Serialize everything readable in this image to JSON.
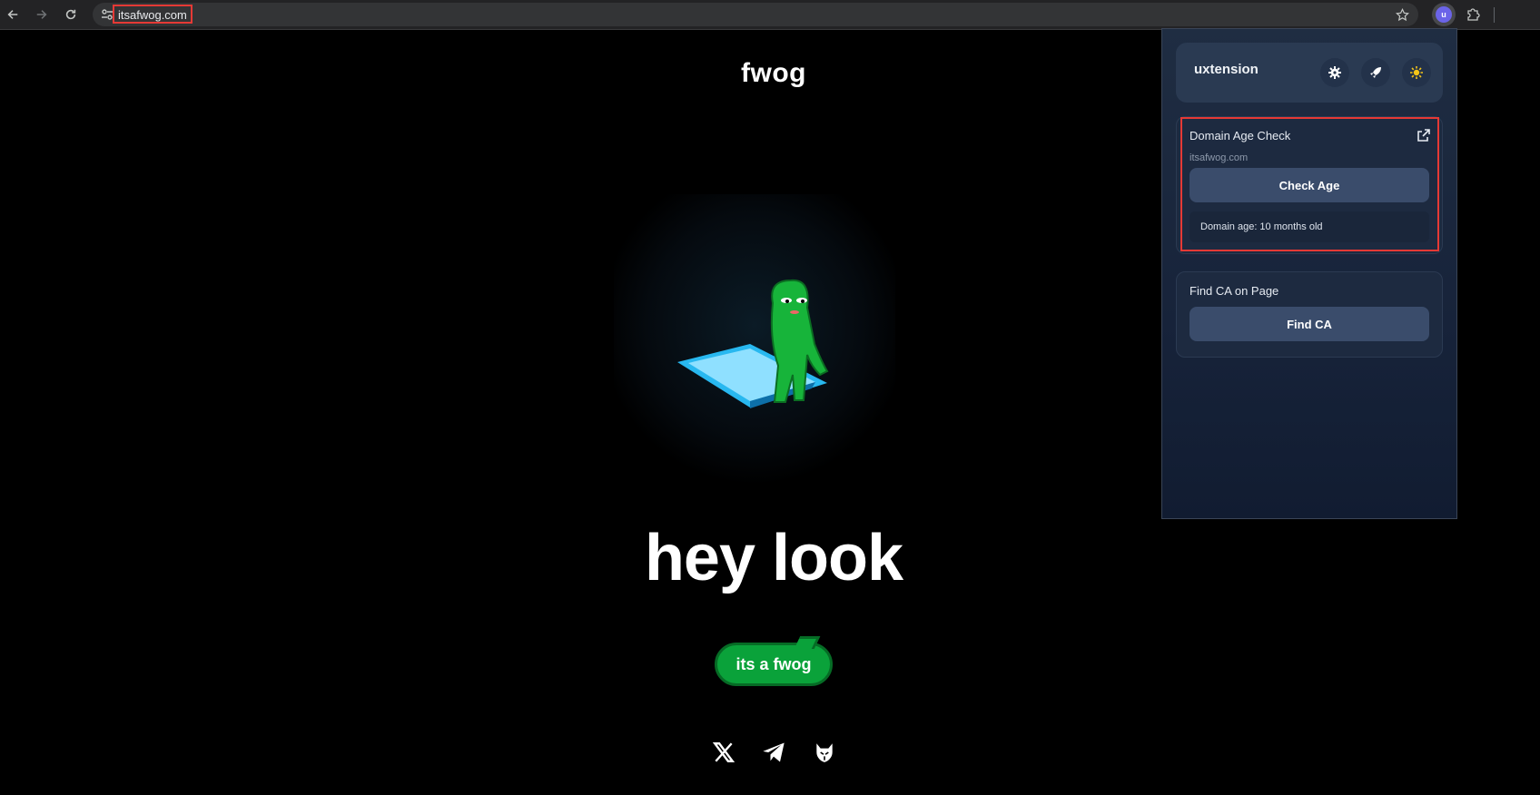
{
  "browser": {
    "url": "itsafwog.com"
  },
  "page": {
    "logo": "fwog",
    "headline": "hey look",
    "cta_label": "its a fwog",
    "social": [
      "x-icon",
      "telegram-icon",
      "dexscreener-icon"
    ]
  },
  "extension": {
    "name": "uxtension",
    "avatar_letter": "u",
    "domain_card": {
      "title": "Domain Age Check",
      "domain": "itsafwog.com",
      "button_label": "Check Age",
      "result": "Domain age: 10 months old"
    },
    "findca_card": {
      "title": "Find CA on Page",
      "button_label": "Find CA"
    },
    "colors": {
      "accent_sun": "#f5c518",
      "button": "#3a4c6b",
      "highlight": "#e53935"
    }
  }
}
